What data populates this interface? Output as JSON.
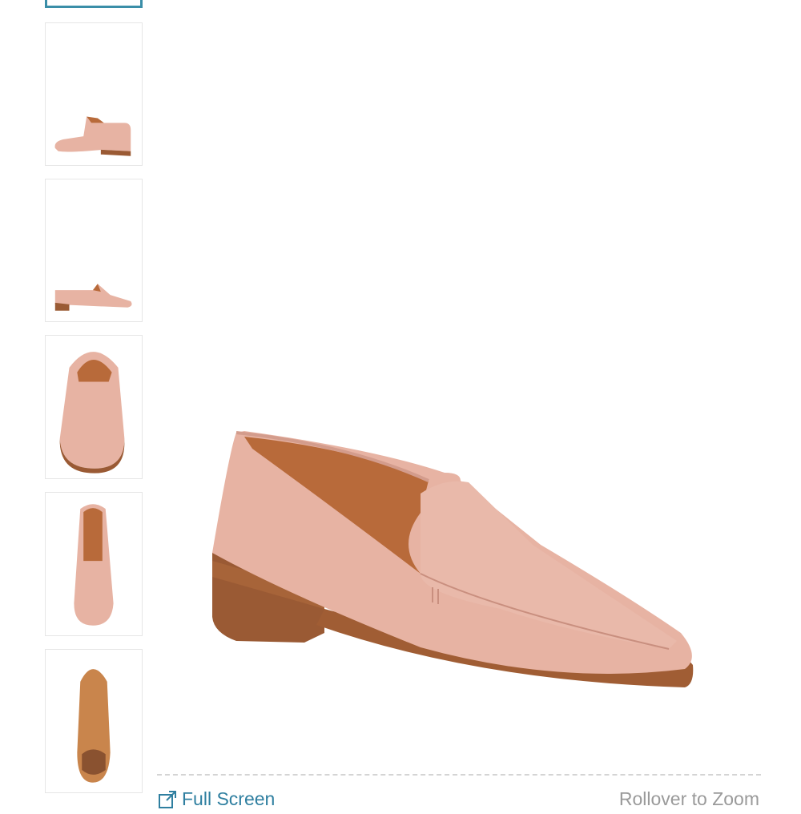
{
  "gallery": {
    "thumbnails": [
      {
        "view": "active-top",
        "selected": true
      },
      {
        "view": "side-left"
      },
      {
        "view": "side-right"
      },
      {
        "view": "front"
      },
      {
        "view": "top"
      },
      {
        "view": "sole"
      }
    ]
  },
  "main_image": {
    "view": "three-quarter",
    "color": "#e7b3a3"
  },
  "actions": {
    "full_screen_label": "Full Screen",
    "zoom_hint": "Rollover to Zoom"
  },
  "colors": {
    "accent": "#2f7fa0",
    "selected_border": "#3a8ea8",
    "shoe_upper": "#e7b3a3",
    "shoe_lining": "#b86a3a",
    "heel": "#9a5a34"
  }
}
